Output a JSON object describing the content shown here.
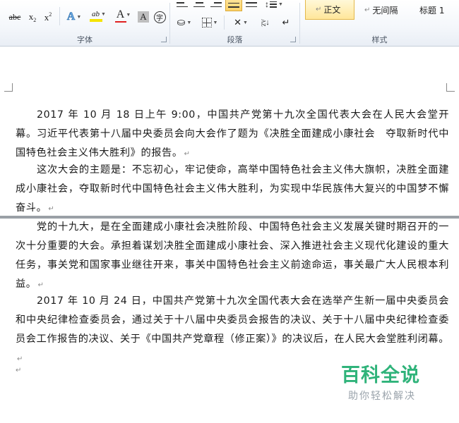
{
  "ribbon": {
    "font_group": {
      "label": "字体",
      "strike_label": "abc",
      "subscript_label": "x",
      "subscript_suffix": "2",
      "superscript_label": "x",
      "superscript_suffix": "2",
      "text_effect_label": "A",
      "highlight_label": "ab",
      "font_color_label": "A",
      "char_shading_label": "A",
      "enclose_label": "字"
    },
    "paragraph_group": {
      "label": "段落",
      "sort_label": "AZ"
    },
    "styles_group": {
      "label": "样式",
      "items": [
        {
          "label": "正文",
          "mark": "↵"
        },
        {
          "label": "无间隔",
          "mark": "↵"
        },
        {
          "label": "标题 1",
          "mark": ""
        }
      ]
    },
    "colors": {
      "highlight": "#f5e400",
      "font_color": "#e02020"
    }
  },
  "document": {
    "paragraphs": [
      "2017 年 10 月 18 日上午 9:00，中国共产党第十九次全国代表大会在人民大会堂开幕。习近平代表第十八届中央委员会向大会作了题为《决胜全面建成小康社会　夺取新时代中国特色社会主义伟大胜利》的报告。",
      "这次大会的主题是：不忘初心，牢记使命，高举中国特色社会主义伟大旗帜，决胜全面建成小康社会，夺取新时代中国特色社会主义伟大胜利，为实现中华民族伟大复兴的中国梦不懈奋斗。",
      "党的十九大，是在全面建成小康社会决胜阶段、中国特色社会主义发展关键时期召开的一次十分重要的大会。承担着谋划决胜全面建成小康社会、深入推进社会主义现代化建设的重大任务，事关党和国家事业继往开来，事关中国特色社会主义前途命运，事关最广大人民根本利益。",
      "2017 年 10 月 24 日，中国共产党第十九次全国代表大会在选举产生新一届中央委员会和中央纪律检查委员会，通过关于十八届中央委员会报告的决议、关于十八届中央纪律检查委员会工作报告的决议、关于《中国共产党章程（修正案）》的决议后，在人民大会堂胜利闭幕。"
    ],
    "return_mark": "↵"
  },
  "watermark": {
    "title": "百科全说",
    "subtitle": "助你轻松解决",
    "color": "#2fb37a"
  }
}
